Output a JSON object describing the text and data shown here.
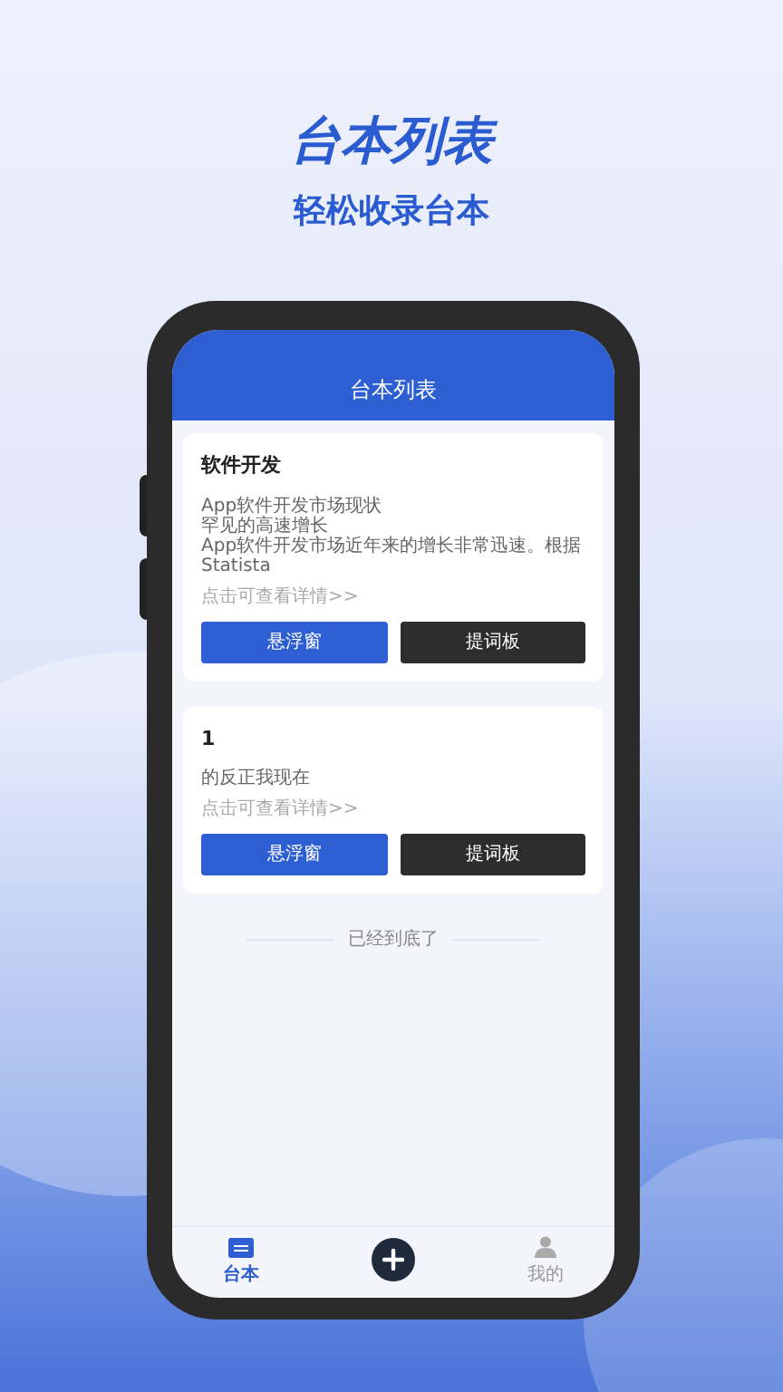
{
  "headline": "台本列表",
  "subtitle": "轻松收录台本",
  "app": {
    "title": "台本列表",
    "scripts": [
      {
        "title": "软件开发",
        "lines": [
          "App软件开发市场现状",
          "罕见的高速增长",
          "App软件开发市场近年来的增长非常迅速。根据Statista"
        ],
        "more": "点击可查看详情>>",
        "buttons": [
          {
            "label": "悬浮窗",
            "kind": "primary"
          },
          {
            "label": "提词板",
            "kind": "dark"
          }
        ]
      },
      {
        "title": "1",
        "lines": [
          "的反正我现在"
        ],
        "more": "点击可查看详情>>",
        "buttons": [
          {
            "label": "悬浮窗",
            "kind": "primary"
          },
          {
            "label": "提词板",
            "kind": "dark"
          }
        ]
      }
    ],
    "end_text": "已经到底了",
    "nav": [
      {
        "kind": "scripts",
        "label": "台本",
        "selected": true
      },
      {
        "kind": "add"
      },
      {
        "kind": "profile",
        "label": "我的",
        "selected": false
      }
    ]
  }
}
